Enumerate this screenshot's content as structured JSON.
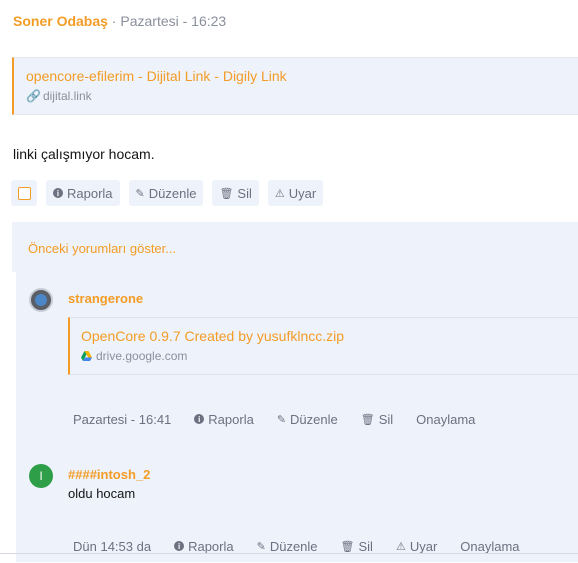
{
  "post": {
    "author": "Soner Odabaş",
    "separator": " · ",
    "time": "Pazartesi - 16:23",
    "link_title": "opencore-efilerim - Dijital Link - Digily Link",
    "link_domain": "dijital.link",
    "text": "linki çalışmıyor hocam.",
    "actions": {
      "report": "Raporla",
      "edit": "Düzenle",
      "delete": "Sil",
      "warn": "Uyar"
    }
  },
  "comments": {
    "show_previous": "Önceki yorumları göster...",
    "items": [
      {
        "author": "strangerone",
        "link_title": "OpenCore 0.9.7 Created by yusufklncc.zip",
        "link_domain": "drive.google.com",
        "time": "Pazartesi - 16:41",
        "report": "Raporla",
        "edit": "Düzenle",
        "delete": "Sil",
        "approve": "Onaylama"
      },
      {
        "author": "####intosh_2",
        "avatar_letter": "I",
        "text": "oldu hocam",
        "time": "Dün 14:53 da",
        "report": "Raporla",
        "edit": "Düzenle",
        "delete": "Sil",
        "warn": "Uyar",
        "approve": "Onaylama"
      }
    ]
  },
  "colors": {
    "accent": "#f39c26",
    "muted": "#8a8f9c",
    "panel": "#eef2fb"
  }
}
